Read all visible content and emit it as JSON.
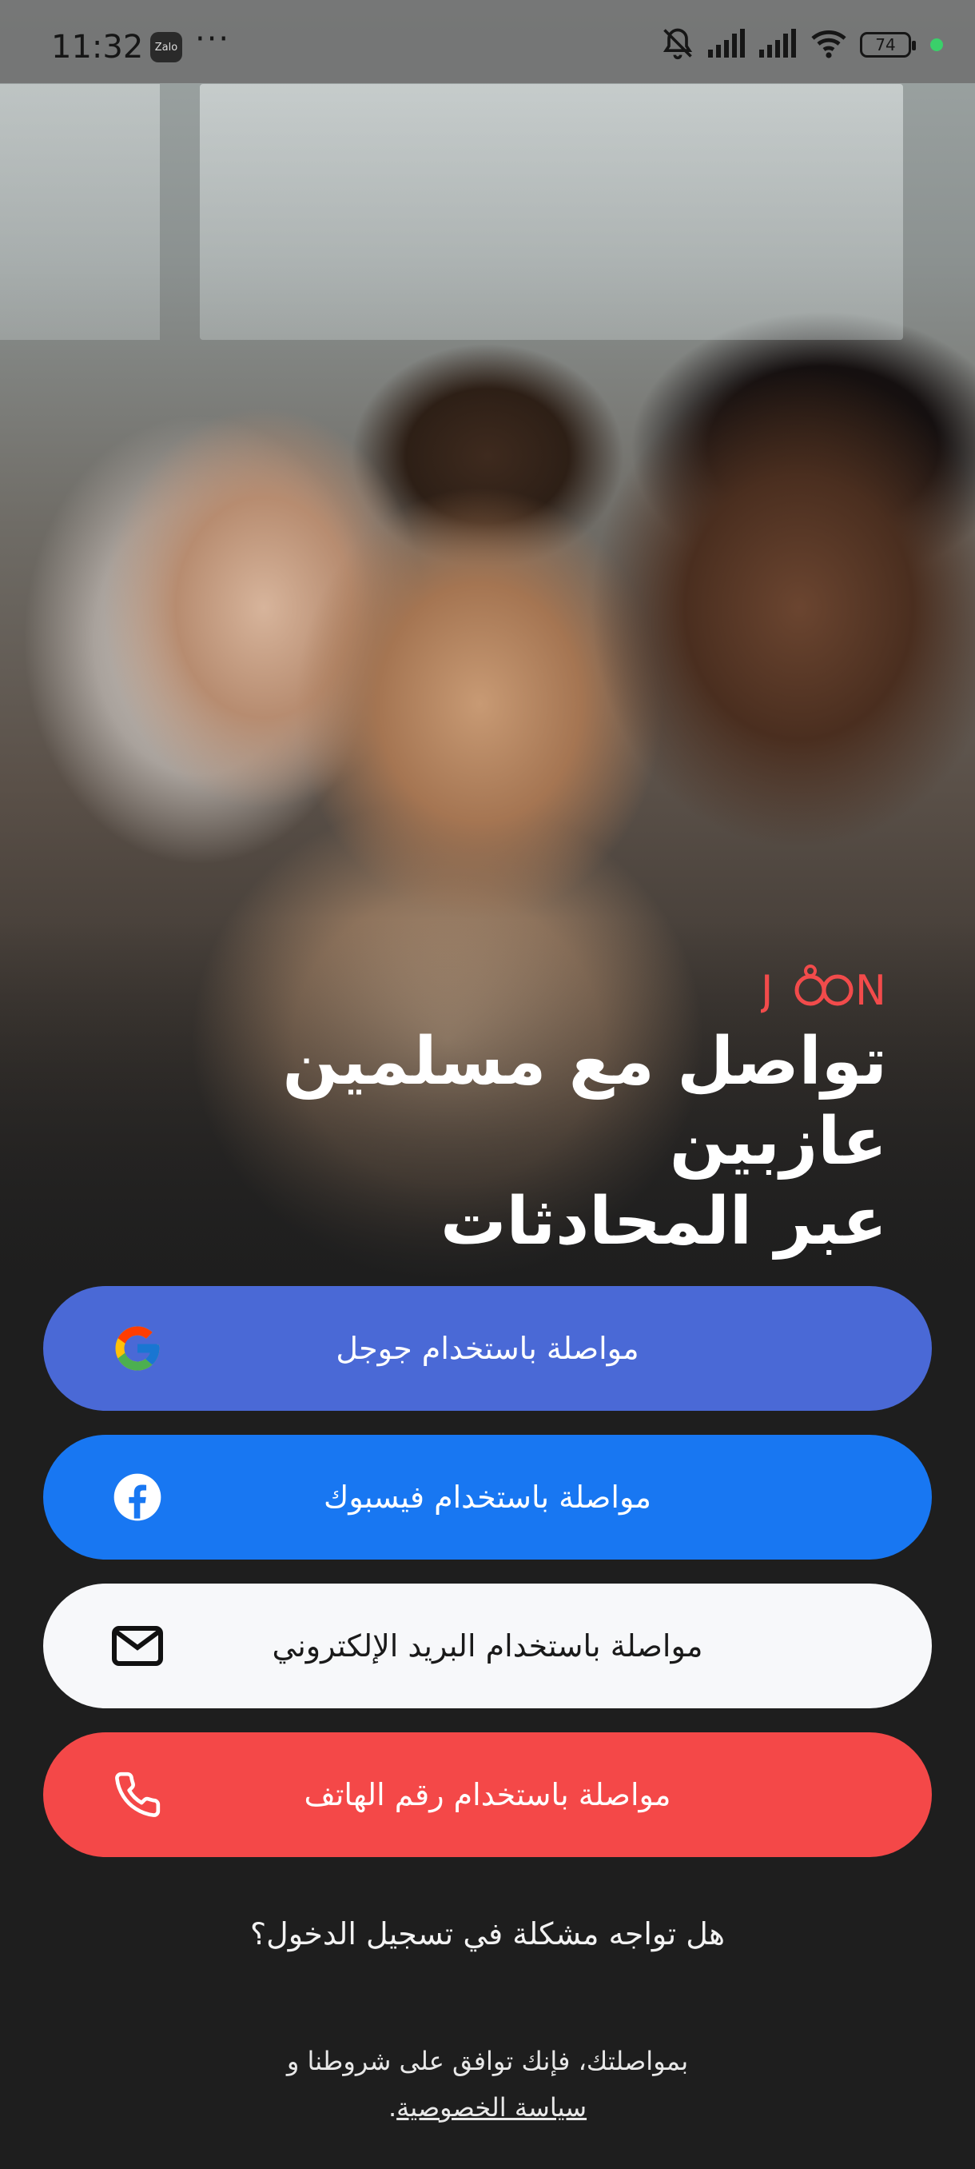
{
  "status_bar": {
    "time": "11:32",
    "notification_app": "Zalo",
    "more_indicator": "···",
    "battery_level": "74",
    "icons": [
      "bell-muted-icon",
      "signal-icon",
      "signal-icon",
      "wifi-icon",
      "battery-icon"
    ]
  },
  "brand": {
    "logo_text": "JOON",
    "accent_color": "#f24b4b"
  },
  "headline": {
    "line1": "تواصل مع مسلمين عازبين",
    "line2": "عبر المحادثات"
  },
  "buttons": {
    "google": {
      "label": "مواصلة باستخدام جوجل",
      "icon": "google-icon",
      "color": "#4a69d6"
    },
    "facebook": {
      "label": "مواصلة باستخدام فيسبوك",
      "icon": "facebook-icon",
      "color": "#1877f2"
    },
    "email": {
      "label": "مواصلة باستخدام البريد الإلكتروني",
      "icon": "mail-icon",
      "color": "#f7f8fa"
    },
    "phone": {
      "label": "مواصلة باستخدام رقم الهاتف",
      "icon": "phone-icon",
      "color": "#f44848"
    }
  },
  "help": {
    "text": "هل تواجه مشكلة في تسجيل الدخول؟"
  },
  "terms": {
    "prefix": "بمواصلتك، فإنك توافق على شروطنا و",
    "privacy_link": "سياسة الخصوصية",
    "suffix": "."
  }
}
